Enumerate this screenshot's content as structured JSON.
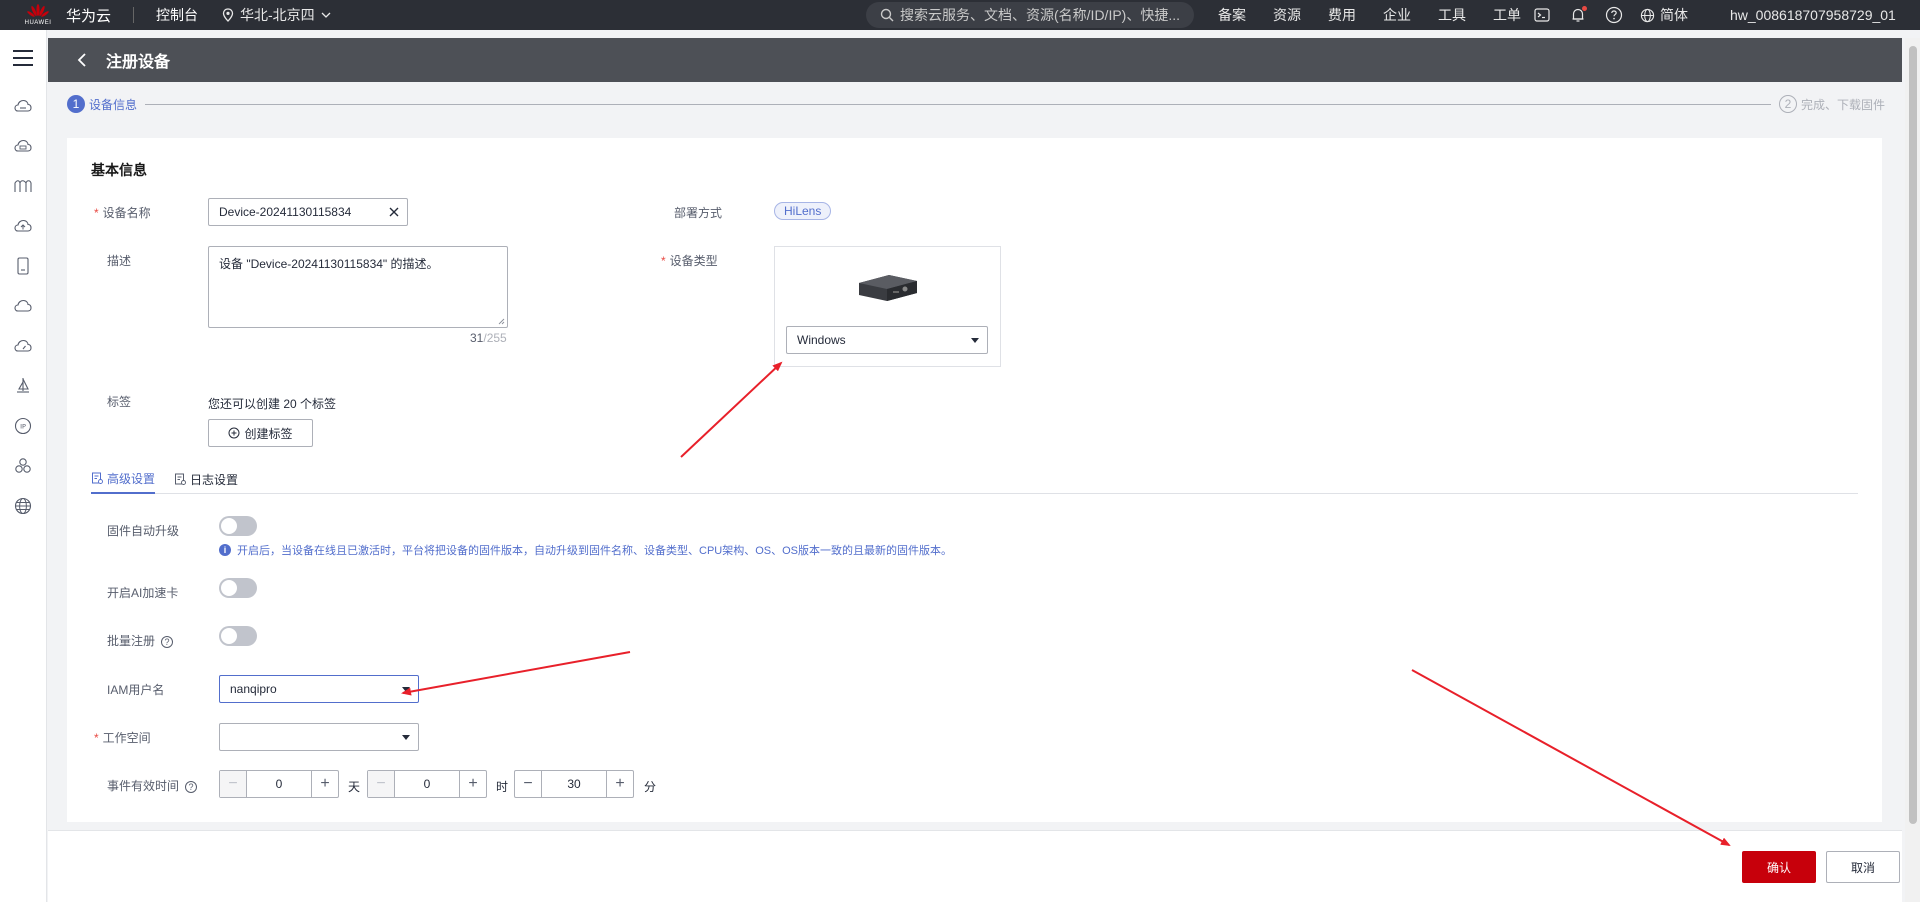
{
  "topbar": {
    "logo_text": "HUAWEI",
    "brand": "华为云",
    "console": "控制台",
    "region": "华北-北京四",
    "search_placeholder": "搜索云服务、文档、资源(名称/ID/IP)、快捷...",
    "links": [
      "备案",
      "资源",
      "费用",
      "企业",
      "工具",
      "工单"
    ],
    "language": "简体",
    "username": "hw_008618707958729_01"
  },
  "page": {
    "title": "注册设备"
  },
  "steps": [
    {
      "num": "1",
      "label": "设备信息"
    },
    {
      "num": "2",
      "label": "完成、下载固件"
    }
  ],
  "basic": {
    "section_title": "基本信息",
    "name_label": "设备名称",
    "name_value": "Device-20241130115834",
    "desc_label": "描述",
    "desc_value": "设备 \"Device-20241130115834\" 的描述。",
    "desc_count": "31",
    "desc_max": "/255",
    "deploy_label": "部署方式",
    "deploy_tag": "HiLens",
    "type_label": "设备类型",
    "type_value": "Windows",
    "tag_label": "标签",
    "tag_hint": "您还可以创建 20 个标签",
    "create_tag_button": "创建标签"
  },
  "tabs": [
    {
      "label": "高级设置"
    },
    {
      "label": "日志设置"
    }
  ],
  "advanced": {
    "firmware_label": "固件自动升级",
    "firmware_info": "开启后，当设备在线且已激活时，平台将把设备的固件版本，自动升级到固件名称、设备类型、CPU架构、OS、OS版本一致的且最新的固件版本。",
    "ai_label": "开启AI加速卡",
    "batch_label": "批量注册",
    "iam_label": "IAM用户名",
    "iam_value": "nanqipro",
    "workspace_label": "工作空间",
    "workspace_value": "",
    "event_label": "事件有效时间",
    "days": "0",
    "days_unit": "天",
    "hours": "0",
    "hours_unit": "时",
    "minutes": "30",
    "minutes_unit": "分"
  },
  "footer": {
    "confirm": "确认",
    "cancel": "取消"
  },
  "colors": {
    "primary_red": "#c7000b",
    "accent_blue": "#526ecc",
    "annotation_arrow": "#e8202a"
  }
}
